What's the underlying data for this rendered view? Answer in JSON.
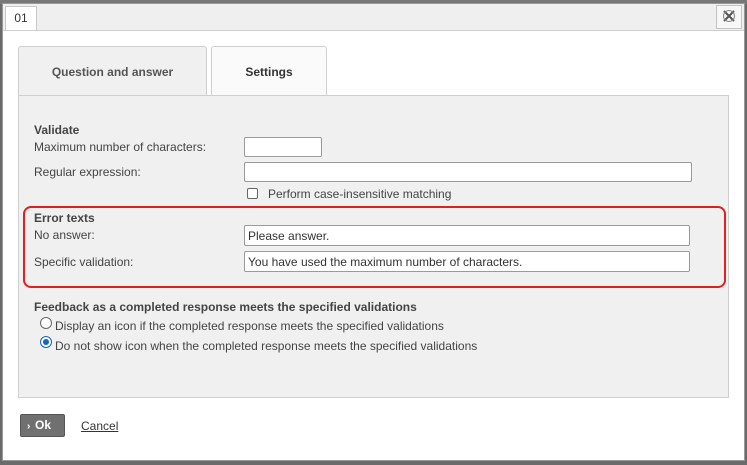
{
  "dialog": {
    "tab_id": "01",
    "close_icon": "close-x-icon"
  },
  "tabs": [
    {
      "label": "Question and answer",
      "active": false
    },
    {
      "label": "Settings",
      "active": true
    }
  ],
  "validate": {
    "heading": "Validate",
    "max_chars_label": "Maximum number of characters:",
    "max_chars_value": "",
    "regex_label": "Regular expression:",
    "regex_value": "",
    "case_insensitive_label": "Perform case-insensitive matching",
    "case_insensitive_checked": false
  },
  "error_texts": {
    "heading": "Error texts",
    "no_answer_label": "No answer:",
    "no_answer_value": "Please answer.",
    "specific_label": "Specific validation:",
    "specific_value": "You have used the maximum number of characters.",
    "highlight_color": "#e02020"
  },
  "feedback": {
    "heading": "Feedback as a completed response meets the specified validations",
    "options": [
      {
        "label": "Display an icon if the completed response meets the specified validations",
        "checked": false
      },
      {
        "label": "Do not show icon when the completed response meets the specified validations",
        "checked": true
      }
    ]
  },
  "footer": {
    "ok_icon": "chevron-right-icon",
    "ok_label": "Ok",
    "cancel_label": "Cancel"
  },
  "colors": {
    "accent": "#1565c0",
    "panel_bg": "#f0f0f0",
    "ok_button_bg": "#707070"
  }
}
